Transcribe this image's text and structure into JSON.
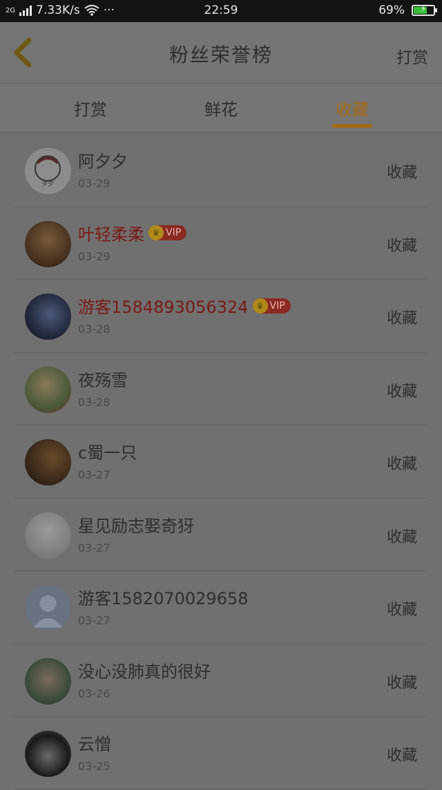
{
  "status_bar": {
    "network": "2G",
    "speed": "7.33K/s",
    "more": "···",
    "time": "22:59",
    "battery": "69%",
    "battery_level": 0.69
  },
  "header": {
    "title": "粉丝荣誉榜",
    "right_link": "打赏"
  },
  "tabs": [
    {
      "label": "打赏",
      "active": false
    },
    {
      "label": "鲜花",
      "active": false
    },
    {
      "label": "收藏",
      "active": true
    }
  ],
  "vip_label": "VIP",
  "accent_color": "#a76a12",
  "rows": [
    {
      "name": "阿夕夕",
      "date": "03-29",
      "action": "收藏",
      "vip": false
    },
    {
      "name": "叶轻柔柔",
      "date": "03-29",
      "action": "收藏",
      "vip": true
    },
    {
      "name": "游客1584893056324",
      "date": "03-28",
      "action": "收藏",
      "vip": true
    },
    {
      "name": "夜殇雪",
      "date": "03-28",
      "action": "收藏",
      "vip": false
    },
    {
      "name": "c蜀一只",
      "date": "03-27",
      "action": "收藏",
      "vip": false
    },
    {
      "name": "星见励志娶奇犽",
      "date": "03-27",
      "action": "收藏",
      "vip": false
    },
    {
      "name": "游客1582070029658",
      "date": "03-27",
      "action": "收藏",
      "vip": false
    },
    {
      "name": "没心没肺真的很好",
      "date": "03-26",
      "action": "收藏",
      "vip": false
    },
    {
      "name": "云憎",
      "date": "03-25",
      "action": "收藏",
      "vip": false
    }
  ]
}
